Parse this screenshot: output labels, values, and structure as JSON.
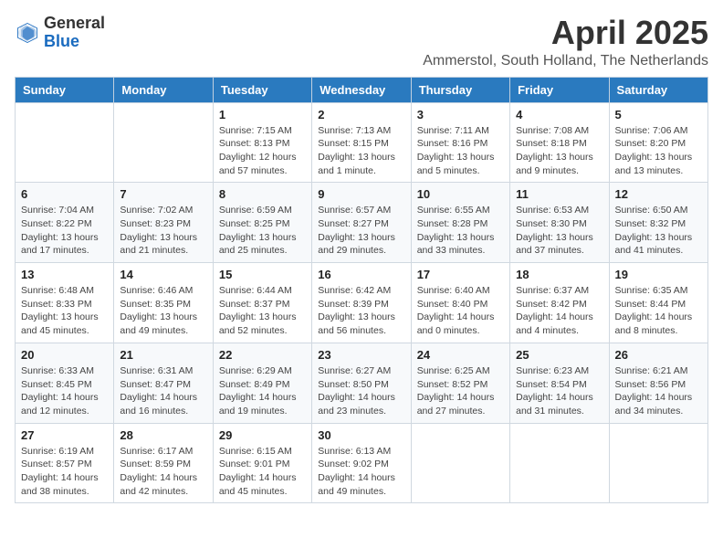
{
  "logo": {
    "general": "General",
    "blue": "Blue"
  },
  "title": "April 2025",
  "subtitle": "Ammerstol, South Holland, The Netherlands",
  "days_of_week": [
    "Sunday",
    "Monday",
    "Tuesday",
    "Wednesday",
    "Thursday",
    "Friday",
    "Saturday"
  ],
  "weeks": [
    [
      {
        "day": "",
        "info": ""
      },
      {
        "day": "",
        "info": ""
      },
      {
        "day": "1",
        "info": "Sunrise: 7:15 AM\nSunset: 8:13 PM\nDaylight: 12 hours and 57 minutes."
      },
      {
        "day": "2",
        "info": "Sunrise: 7:13 AM\nSunset: 8:15 PM\nDaylight: 13 hours and 1 minute."
      },
      {
        "day": "3",
        "info": "Sunrise: 7:11 AM\nSunset: 8:16 PM\nDaylight: 13 hours and 5 minutes."
      },
      {
        "day": "4",
        "info": "Sunrise: 7:08 AM\nSunset: 8:18 PM\nDaylight: 13 hours and 9 minutes."
      },
      {
        "day": "5",
        "info": "Sunrise: 7:06 AM\nSunset: 8:20 PM\nDaylight: 13 hours and 13 minutes."
      }
    ],
    [
      {
        "day": "6",
        "info": "Sunrise: 7:04 AM\nSunset: 8:22 PM\nDaylight: 13 hours and 17 minutes."
      },
      {
        "day": "7",
        "info": "Sunrise: 7:02 AM\nSunset: 8:23 PM\nDaylight: 13 hours and 21 minutes."
      },
      {
        "day": "8",
        "info": "Sunrise: 6:59 AM\nSunset: 8:25 PM\nDaylight: 13 hours and 25 minutes."
      },
      {
        "day": "9",
        "info": "Sunrise: 6:57 AM\nSunset: 8:27 PM\nDaylight: 13 hours and 29 minutes."
      },
      {
        "day": "10",
        "info": "Sunrise: 6:55 AM\nSunset: 8:28 PM\nDaylight: 13 hours and 33 minutes."
      },
      {
        "day": "11",
        "info": "Sunrise: 6:53 AM\nSunset: 8:30 PM\nDaylight: 13 hours and 37 minutes."
      },
      {
        "day": "12",
        "info": "Sunrise: 6:50 AM\nSunset: 8:32 PM\nDaylight: 13 hours and 41 minutes."
      }
    ],
    [
      {
        "day": "13",
        "info": "Sunrise: 6:48 AM\nSunset: 8:33 PM\nDaylight: 13 hours and 45 minutes."
      },
      {
        "day": "14",
        "info": "Sunrise: 6:46 AM\nSunset: 8:35 PM\nDaylight: 13 hours and 49 minutes."
      },
      {
        "day": "15",
        "info": "Sunrise: 6:44 AM\nSunset: 8:37 PM\nDaylight: 13 hours and 52 minutes."
      },
      {
        "day": "16",
        "info": "Sunrise: 6:42 AM\nSunset: 8:39 PM\nDaylight: 13 hours and 56 minutes."
      },
      {
        "day": "17",
        "info": "Sunrise: 6:40 AM\nSunset: 8:40 PM\nDaylight: 14 hours and 0 minutes."
      },
      {
        "day": "18",
        "info": "Sunrise: 6:37 AM\nSunset: 8:42 PM\nDaylight: 14 hours and 4 minutes."
      },
      {
        "day": "19",
        "info": "Sunrise: 6:35 AM\nSunset: 8:44 PM\nDaylight: 14 hours and 8 minutes."
      }
    ],
    [
      {
        "day": "20",
        "info": "Sunrise: 6:33 AM\nSunset: 8:45 PM\nDaylight: 14 hours and 12 minutes."
      },
      {
        "day": "21",
        "info": "Sunrise: 6:31 AM\nSunset: 8:47 PM\nDaylight: 14 hours and 16 minutes."
      },
      {
        "day": "22",
        "info": "Sunrise: 6:29 AM\nSunset: 8:49 PM\nDaylight: 14 hours and 19 minutes."
      },
      {
        "day": "23",
        "info": "Sunrise: 6:27 AM\nSunset: 8:50 PM\nDaylight: 14 hours and 23 minutes."
      },
      {
        "day": "24",
        "info": "Sunrise: 6:25 AM\nSunset: 8:52 PM\nDaylight: 14 hours and 27 minutes."
      },
      {
        "day": "25",
        "info": "Sunrise: 6:23 AM\nSunset: 8:54 PM\nDaylight: 14 hours and 31 minutes."
      },
      {
        "day": "26",
        "info": "Sunrise: 6:21 AM\nSunset: 8:56 PM\nDaylight: 14 hours and 34 minutes."
      }
    ],
    [
      {
        "day": "27",
        "info": "Sunrise: 6:19 AM\nSunset: 8:57 PM\nDaylight: 14 hours and 38 minutes."
      },
      {
        "day": "28",
        "info": "Sunrise: 6:17 AM\nSunset: 8:59 PM\nDaylight: 14 hours and 42 minutes."
      },
      {
        "day": "29",
        "info": "Sunrise: 6:15 AM\nSunset: 9:01 PM\nDaylight: 14 hours and 45 minutes."
      },
      {
        "day": "30",
        "info": "Sunrise: 6:13 AM\nSunset: 9:02 PM\nDaylight: 14 hours and 49 minutes."
      },
      {
        "day": "",
        "info": ""
      },
      {
        "day": "",
        "info": ""
      },
      {
        "day": "",
        "info": ""
      }
    ]
  ]
}
